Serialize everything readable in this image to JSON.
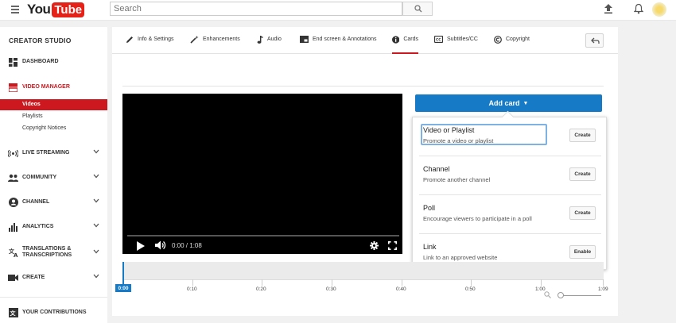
{
  "header": {
    "logo_you": "You",
    "logo_tube": "Tube",
    "search_placeholder": "Search"
  },
  "sidebar": {
    "title": "CREATOR STUDIO",
    "items": [
      {
        "label": "DASHBOARD",
        "icon": "dashboard-icon"
      },
      {
        "label": "VIDEO MANAGER",
        "icon": "video-manager-icon",
        "active": true
      },
      {
        "label": "LIVE STREAMING",
        "icon": "live-streaming-icon"
      },
      {
        "label": "COMMUNITY",
        "icon": "community-icon"
      },
      {
        "label": "CHANNEL",
        "icon": "channel-icon"
      },
      {
        "label": "ANALYTICS",
        "icon": "analytics-icon"
      },
      {
        "label": "TRANSLATIONS & TRANSCRIPTIONS",
        "label_line1": "TRANSLATIONS &",
        "label_line2": "TRANSCRIPTIONS",
        "icon": "translate-icon"
      },
      {
        "label": "CREATE",
        "icon": "create-icon"
      },
      {
        "label": "YOUR CONTRIBUTIONS",
        "icon": "contributions-icon"
      }
    ],
    "video_manager_sub": [
      "Videos",
      "Playlists",
      "Copyright Notices"
    ],
    "active_sub": "Videos"
  },
  "tabs": [
    {
      "label": "Info & Settings",
      "icon": "pencil-icon"
    },
    {
      "label": "Enhancements",
      "icon": "magic-wand-icon"
    },
    {
      "label": "Audio",
      "icon": "music-note-icon"
    },
    {
      "label": "End screen & Annotations",
      "icon": "end-screen-icon"
    },
    {
      "label": "Cards",
      "icon": "info-icon",
      "active": true
    },
    {
      "label": "Subtitles/CC",
      "icon": "cc-icon"
    },
    {
      "label": "Copyright",
      "icon": "copyright-icon"
    }
  ],
  "player": {
    "time": "0:00 / 1:08",
    "progress": 0
  },
  "add_card": {
    "label": "Add card",
    "options": [
      {
        "title": "Video or Playlist",
        "desc": "Promote a video or playlist",
        "button": "Create",
        "focused": true
      },
      {
        "title": "Channel",
        "desc": "Promote another channel",
        "button": "Create"
      },
      {
        "title": "Poll",
        "desc": "Encourage viewers to participate in a poll",
        "button": "Create"
      },
      {
        "title": "Link",
        "desc": "Link to an approved website",
        "button": "Enable"
      }
    ]
  },
  "timeline": {
    "playhead": "0:00",
    "ticks": [
      "0:10",
      "0:20",
      "0:30",
      "0:40",
      "0:50",
      "1:00",
      "1:09"
    ]
  },
  "colors": {
    "brand_red": "#cc181e",
    "accent_blue": "#167ac6",
    "annotation_arrow": "#f7931e"
  }
}
